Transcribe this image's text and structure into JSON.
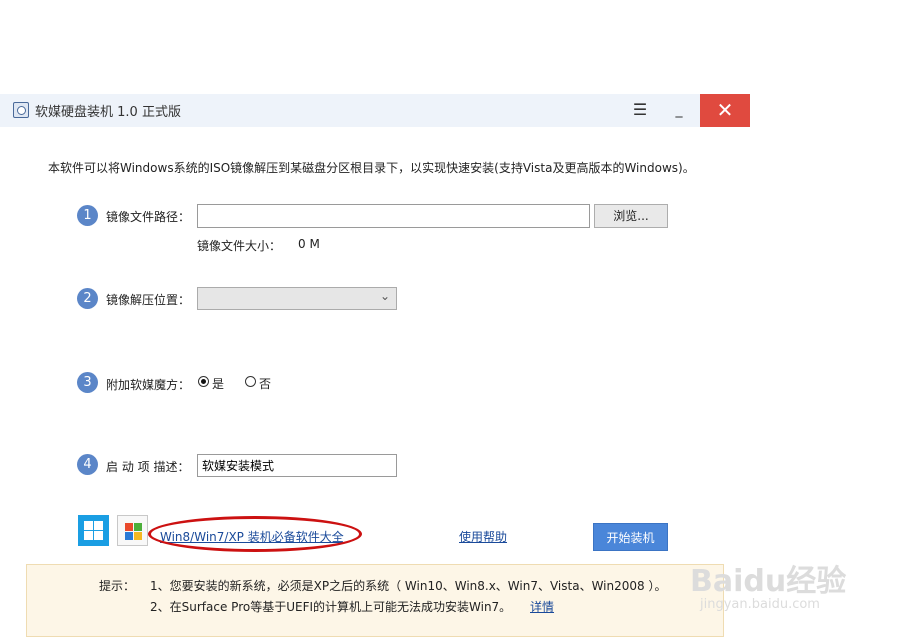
{
  "window": {
    "title": "软媒硬盘装机 1.0 正式版",
    "menu_icon": "menu-icon",
    "minimize": "_",
    "close": "✕"
  },
  "description": "本软件可以将Windows系统的ISO镜像解压到某磁盘分区根目录下，以实现快速安装(支持Vista及更高版本的Windows)。",
  "steps": [
    {
      "num": "1",
      "label": "镜像文件路径：",
      "value": "",
      "browse": "浏览...",
      "size_label": "镜像文件大小：",
      "size_value": "0 M"
    },
    {
      "num": "2",
      "label": "镜像解压位置：",
      "selected": ""
    },
    {
      "num": "3",
      "label": "附加软媒魔方：",
      "yes": "是",
      "no": "否",
      "checked": "是"
    },
    {
      "num": "4",
      "label": "启 动 项 描述：",
      "value": "软媒安装模式"
    }
  ],
  "bottom": {
    "software_link": "Win8/Win7/XP 装机必备软件大全",
    "help_link": "使用帮助",
    "start_button": "开始装机"
  },
  "tips": {
    "title": "提示：",
    "line1": "1、您要安装的新系统，必须是XP之后的系统（ Win10、Win8.x、Win7、Vista、Win2008 ）。",
    "line2": "2、在Surface Pro等基于UEFI的计算机上可能无法成功安装Win7。",
    "detail_link": "详情"
  },
  "watermark": {
    "brand": "Baidu经验",
    "url": "jingyan.baidu.com"
  },
  "colors": {
    "accent": "#4a86d9",
    "close": "#e04a3f",
    "step": "#5b86c8",
    "annotation": "#cc1111"
  }
}
